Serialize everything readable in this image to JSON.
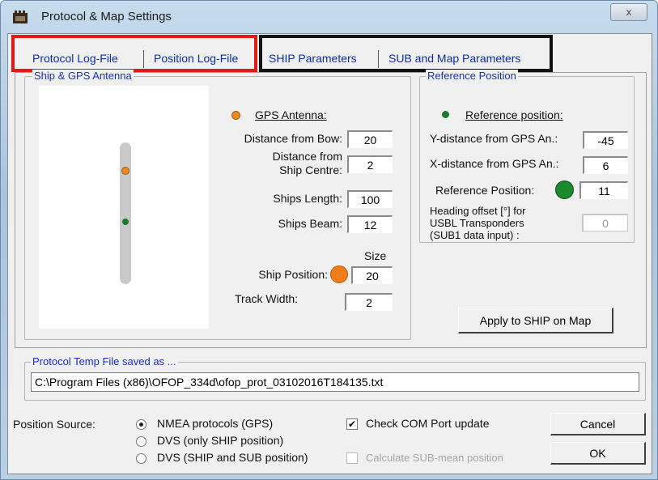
{
  "window": {
    "title": "Protocol & Map Settings",
    "close_label": "x"
  },
  "tabs": [
    {
      "label": "Protocol Log-File"
    },
    {
      "label": "Position Log-File"
    },
    {
      "label": "SHIP Parameters"
    },
    {
      "label": "SUB and Map Parameters"
    }
  ],
  "ship_group": {
    "title": "Ship & GPS Antenna",
    "gps_antenna_label": "GPS Antenna:",
    "distance_bow_label": "Distance  from Bow:",
    "distance_bow_value": "20",
    "distance_centre_label_1": "Distance from",
    "distance_centre_label_2": "Ship Centre:",
    "distance_centre_value": "2",
    "ships_length_label": "Ships Length:",
    "ships_length_value": "100",
    "ships_beam_label": "Ships Beam:",
    "ships_beam_value": "12",
    "size_label": "Size",
    "ship_position_label": "Ship Position:",
    "ship_position_value": "20",
    "track_width_label": "Track Width:",
    "track_width_value": "2"
  },
  "reference_group": {
    "title": "Reference Position",
    "reference_position_label": "Reference position:",
    "y_distance_label": "Y-distance from GPS An.:",
    "y_distance_value": "-45",
    "x_distance_label": "X-distance from GPS An.:",
    "x_distance_value": "6",
    "ref_pos_label": "Reference Position:",
    "ref_pos_value": "11",
    "heading_label_1": "Heading offset [°] for",
    "heading_label_2": "USBL Transponders",
    "heading_label_3": "(SUB1 data input) :",
    "heading_value": "0"
  },
  "apply_button": "Apply to SHIP on Map",
  "temp_file": {
    "title": "Protocol Temp File saved as ...",
    "path": "C:\\Program Files (x86)\\OFOP_334d\\ofop_prot_03102016T184135.txt"
  },
  "position_source": {
    "label": "Position Source:",
    "options": [
      {
        "label": "NMEA protocols (GPS)",
        "selected": true
      },
      {
        "label": "DVS (only SHIP position)",
        "selected": false
      },
      {
        "label": "DVS (SHIP and SUB position)",
        "selected": false
      }
    ]
  },
  "check_com": {
    "label": "Check COM Port update",
    "checked": true
  },
  "calc_sub": {
    "label": "Calculate SUB-mean position",
    "checked": false,
    "disabled": true
  },
  "cancel_button": "Cancel",
  "ok_button": "OK",
  "colors": {
    "gps_antenna": "#e88a1e",
    "reference": "#1c7a2c",
    "ship_position": "#f07d1a",
    "tab_text": "#0b2ea8",
    "highlight_red": "#e01919",
    "highlight_black": "#111111"
  }
}
